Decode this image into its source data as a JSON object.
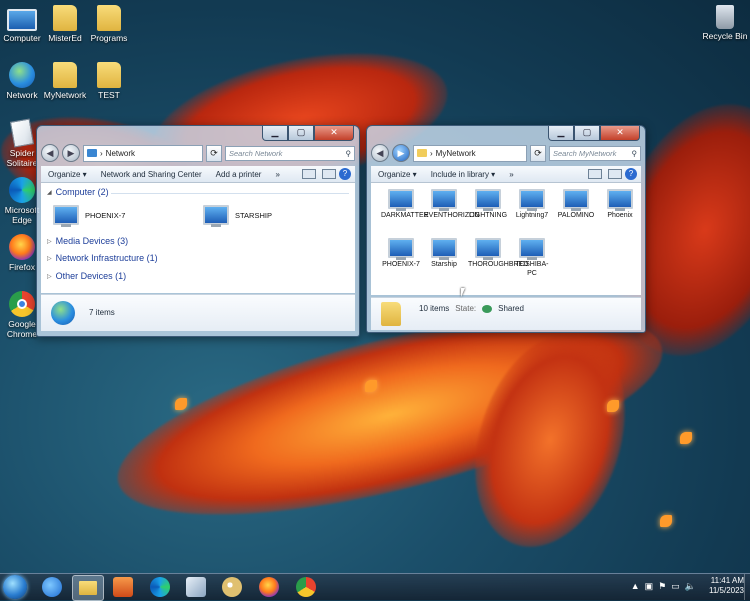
{
  "desktop": {
    "icons": {
      "computer": "Computer",
      "mistered": "MisterEd",
      "programs": "Programs",
      "network": "Network",
      "mynetwork": "MyNetwork",
      "test": "TEST",
      "spider": "Spider Solitaire",
      "edge": "Microsoft Edge",
      "firefox": "Firefox",
      "chrome": "Google Chrome",
      "recycle": "Recycle Bin"
    }
  },
  "network_window": {
    "title_buttons": {
      "min": "▁",
      "max": "▢",
      "close": "✕"
    },
    "address": "Network",
    "address_sep": "›",
    "search_placeholder": "Search Network",
    "toolbar": {
      "organize": "Organize ▾",
      "sharing": "Network and Sharing Center",
      "printer": "Add a printer",
      "more": "»"
    },
    "groups": {
      "computer": "Computer (2)",
      "media": "Media Devices (3)",
      "infra": "Network Infrastructure (1)",
      "other": "Other Devices (1)"
    },
    "computers": [
      "PHOENIX-7",
      "STARSHIP"
    ],
    "status": "7 items"
  },
  "mynetwork_window": {
    "title_buttons": {
      "min": "▁",
      "max": "▢",
      "close": "✕"
    },
    "address": "MyNetwork",
    "address_sep": "›",
    "search_placeholder": "Search MyNetwork",
    "toolbar": {
      "organize": "Organize ▾",
      "library": "Include in library ▾",
      "more": "»"
    },
    "items": [
      "DARKMATTER",
      "EVENTHORIZON",
      "LIGHTNING",
      "Lightning7",
      "PALOMINO",
      "Phoenix",
      "PHOENIX-7",
      "Starship",
      "THOROUGHBRED",
      "TOSHIBA-PC"
    ],
    "status_count": "10 items",
    "state_label": "State:",
    "state_value": "Shared"
  },
  "taskbar": {
    "time": "11:41 AM",
    "date": "11/5/2023",
    "tray_arrow": "▲"
  }
}
